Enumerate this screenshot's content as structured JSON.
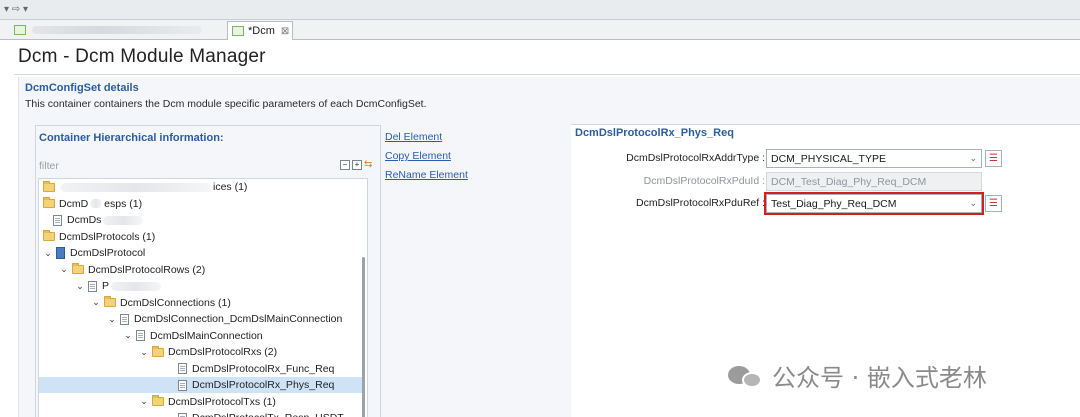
{
  "toolbar": {
    "arrows": "▾  ⇨ ▾"
  },
  "tabs": {
    "active_label": "*Dcm",
    "close_glyph": "⊠"
  },
  "editor": {
    "title": "Dcm - Dcm Module Manager",
    "section_title": "DcmConfigSet details",
    "section_desc": "This container containers the Dcm module specific parameters of each DcmConfigSet."
  },
  "container": {
    "title": "Container Hierarchical information:",
    "filter_placeholder": "filter",
    "tree": [
      {
        "label": "ices (1)",
        "icon": "folder-icon",
        "chevron": ""
      },
      {
        "label": "DcmD",
        "label_tail": "esps (1)",
        "icon": "folder-icon",
        "chevron": ""
      },
      {
        "label": "DcmDs",
        "icon": "doc-icon",
        "chevron": ""
      },
      {
        "label": "DcmDslProtocols (1)",
        "icon": "folder-icon",
        "chevron": ""
      },
      {
        "label": "DcmDslProtocol",
        "icon": "module-icon",
        "chevron": "⌄"
      },
      {
        "label": "DcmDslProtocolRows (2)",
        "icon": "folder-icon",
        "chevron": "⌄"
      },
      {
        "label": "P",
        "icon": "doc-icon",
        "chevron": "⌄"
      },
      {
        "label": "DcmDslConnections (1)",
        "icon": "folder-icon",
        "chevron": "⌄"
      },
      {
        "label": "DcmDslConnection_DcmDslMainConnection",
        "icon": "doc-icon",
        "chevron": "⌄"
      },
      {
        "label": "DcmDslMainConnection",
        "icon": "doc-icon",
        "chevron": "⌄"
      },
      {
        "label": "DcmDslProtocolRxs (2)",
        "icon": "folder-icon",
        "chevron": "⌄"
      },
      {
        "label": "DcmDslProtocolRx_Func_Req",
        "icon": "doc-icon",
        "chevron": ""
      },
      {
        "label": "DcmDslProtocolRx_Phys_Req",
        "icon": "doc-icon",
        "chevron": "",
        "selected": true
      },
      {
        "label": "DcmDslProtocolTxs (1)",
        "icon": "folder-icon",
        "chevron": "⌄"
      },
      {
        "label": "DcmDslProtocolTx_Resp_USDT",
        "icon": "doc-icon",
        "chevron": ""
      }
    ]
  },
  "actions": {
    "delete": "Del Element",
    "copy": "Copy Element",
    "rename": "ReName Element"
  },
  "details": {
    "title": "DcmDslProtocolRx_Phys_Req",
    "fields": [
      {
        "label": "DcmDslProtocolRxAddrType :",
        "value": "DCM_PHYSICAL_TYPE"
      },
      {
        "label": "DcmDslProtocolRxPduId :",
        "value": "DCM_Test_Diag_Phy_Req_DCM"
      },
      {
        "label": "DcmDslProtocolRxPduRef :",
        "value": "Test_Diag_Phy_Req_DCM"
      }
    ]
  },
  "watermark": {
    "text": "公众号 · 嵌入式老林"
  },
  "colors": {
    "accent": "#2a5d9e",
    "highlight": "#d21e1e",
    "selection": "#cfe3f7"
  }
}
